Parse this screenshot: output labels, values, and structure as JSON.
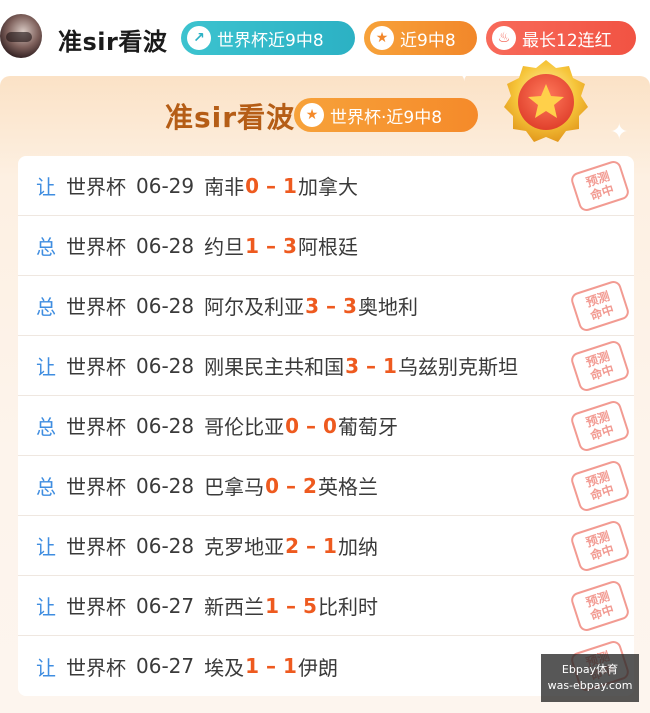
{
  "header": {
    "name": "准sir看波",
    "pills": [
      {
        "icon": "arrow-up-icon",
        "label": "世界杯近9中8"
      },
      {
        "icon": "star-icon",
        "label": "近9中8"
      },
      {
        "icon": "flame-icon",
        "label": "最长12连红"
      }
    ]
  },
  "card": {
    "title": "准sir看波",
    "pill_label": "世界杯·近9中8",
    "stamp_text_1": "预测",
    "stamp_text_2": "命中"
  },
  "rows": [
    {
      "tag": "让",
      "league": "世界杯",
      "date": "06-29",
      "home": "南非",
      "home_score": "0",
      "away_score": "1",
      "away": "加拿大",
      "hit": true
    },
    {
      "tag": "总",
      "league": "世界杯",
      "date": "06-28",
      "home": "约旦",
      "home_score": "1",
      "away_score": "3",
      "away": "阿根廷",
      "hit": false
    },
    {
      "tag": "总",
      "league": "世界杯",
      "date": "06-28",
      "home": "阿尔及利亚",
      "home_score": "3",
      "away_score": "3",
      "away": "奥地利",
      "hit": true
    },
    {
      "tag": "让",
      "league": "世界杯",
      "date": "06-28",
      "home": "刚果民主共和国",
      "home_score": "3",
      "away_score": "1",
      "away": "乌兹别克斯坦",
      "hit": true
    },
    {
      "tag": "总",
      "league": "世界杯",
      "date": "06-28",
      "home": "哥伦比亚",
      "home_score": "0",
      "away_score": "0",
      "away": "葡萄牙",
      "hit": true
    },
    {
      "tag": "总",
      "league": "世界杯",
      "date": "06-28",
      "home": "巴拿马",
      "home_score": "0",
      "away_score": "2",
      "away": "英格兰",
      "hit": true
    },
    {
      "tag": "让",
      "league": "世界杯",
      "date": "06-28",
      "home": "克罗地亚",
      "home_score": "2",
      "away_score": "1",
      "away": "加纳",
      "hit": true
    },
    {
      "tag": "让",
      "league": "世界杯",
      "date": "06-27",
      "home": "新西兰",
      "home_score": "1",
      "away_score": "5",
      "away": "比利时",
      "hit": true
    },
    {
      "tag": "让",
      "league": "世界杯",
      "date": "06-27",
      "home": "埃及",
      "home_score": "1",
      "away_score": "1",
      "away": "伊朗",
      "hit": true
    }
  ],
  "watermark": {
    "line1": "Ebpay体育",
    "line2": "was-ebpay.com"
  }
}
